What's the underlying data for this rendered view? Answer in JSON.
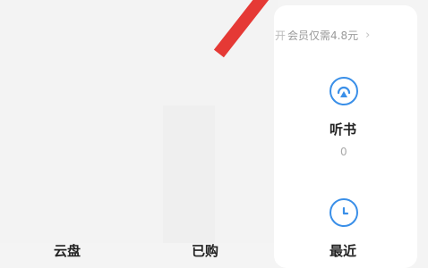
{
  "promo": {
    "prefix": "开",
    "text": "会员仅需4.8元",
    "chevron": "›"
  },
  "sections": [
    {
      "label": "听书",
      "count": "0",
      "icon": "headphones-icon"
    },
    {
      "label": "最近",
      "icon": "clock-icon"
    }
  ],
  "bottom_tabs": [
    {
      "label": "云盘"
    },
    {
      "label": "已购"
    }
  ],
  "colors": {
    "accent": "#3a8fe8",
    "ribbon": "#e53935"
  }
}
